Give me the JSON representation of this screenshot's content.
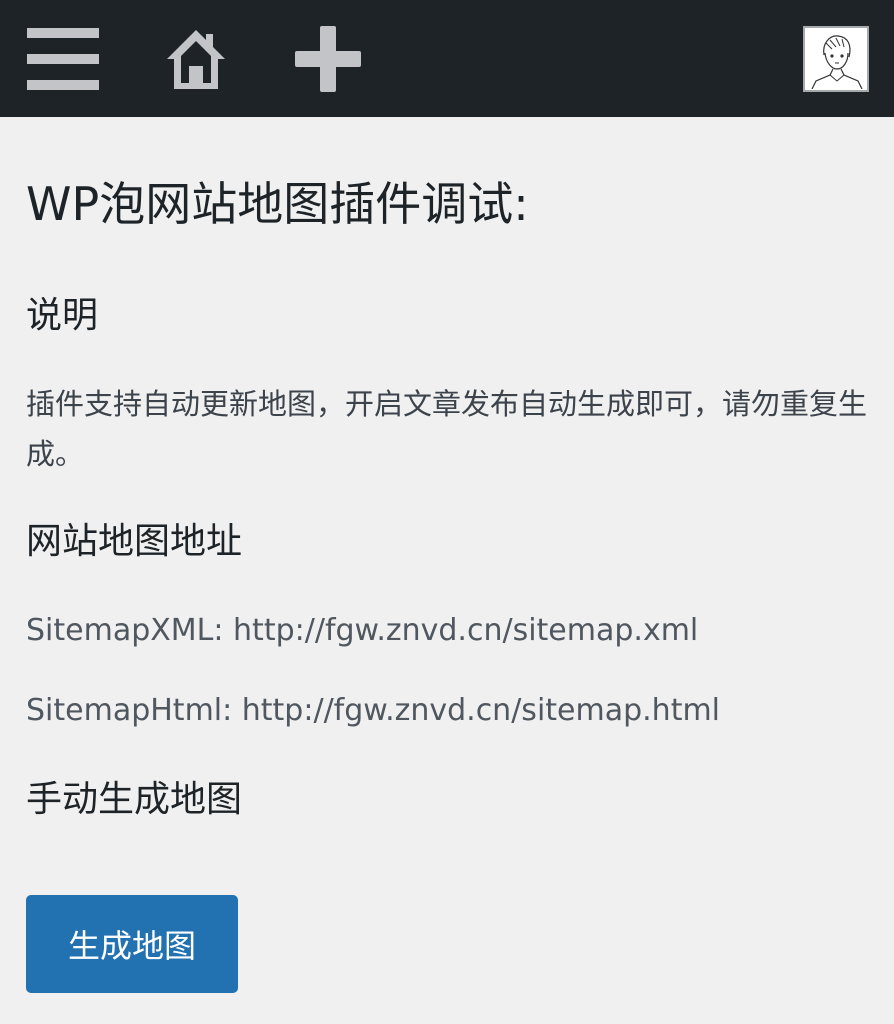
{
  "topbar": {
    "icons": {
      "menu": "menu-icon",
      "home": "home-icon",
      "new": "plus-icon",
      "avatar": "user-avatar"
    },
    "colors": {
      "background": "#1d2327",
      "icon": "#c3c4c7"
    }
  },
  "page": {
    "title": "WP泡网站地图插件调试:",
    "sections": {
      "description": {
        "heading": "说明",
        "text": "插件支持自动更新地图，开启文章发布自动生成即可，请勿重复生成。"
      },
      "sitemap_urls": {
        "heading": "网站地图地址",
        "xml": "SitemapXML: http://fgw.znvd.cn/sitemap.xml",
        "html": "SitemapHtml: http://fgw.znvd.cn/sitemap.html"
      },
      "manual": {
        "heading": "手动生成地图",
        "button_label": "生成地图"
      }
    }
  },
  "colors": {
    "page_background": "#f0f0f1",
    "button": "#2271b1",
    "button_text": "#ffffff"
  }
}
